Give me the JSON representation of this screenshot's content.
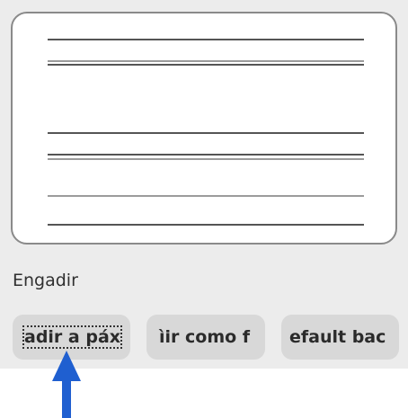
{
  "section_label": "Engadir",
  "buttons": [
    {
      "label": "adir a páx"
    },
    {
      "label": "ìir como f"
    },
    {
      "label": "efault bac"
    }
  ],
  "colors": {
    "panel_bg": "#ececec",
    "button_bg": "#d8d8d8",
    "arrow": "#1f5fd0"
  },
  "icons": {
    "pointer": "up-arrow-icon"
  }
}
